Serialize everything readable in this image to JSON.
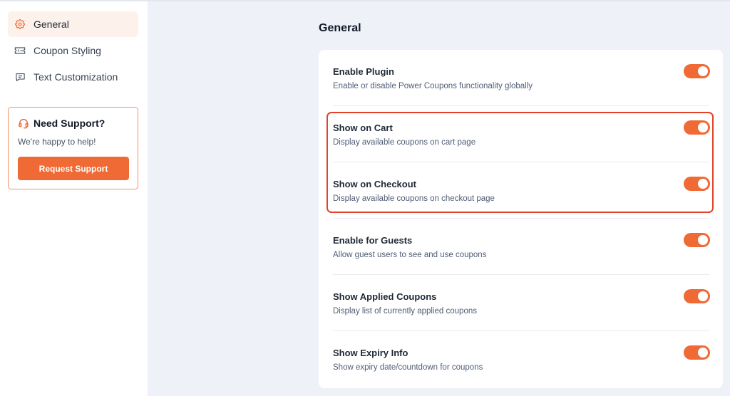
{
  "sidebar": {
    "items": [
      {
        "label": "General",
        "icon": "gear-icon",
        "active": true
      },
      {
        "label": "Coupon Styling",
        "icon": "ticket-icon",
        "active": false
      },
      {
        "label": "Text Customization",
        "icon": "chat-bubble-icon",
        "active": false
      }
    ],
    "support": {
      "title": "Need Support?",
      "subtitle": "We're happy to help!",
      "button_label": "Request Support",
      "icon": "headset-icon"
    }
  },
  "main": {
    "title": "General",
    "settings": [
      {
        "title": "Enable Plugin",
        "description": "Enable or disable Power Coupons functionality globally",
        "enabled": true
      },
      {
        "title": "Show on Cart",
        "description": "Display available coupons on cart page",
        "enabled": true
      },
      {
        "title": "Show on Checkout",
        "description": "Display available coupons on checkout page",
        "enabled": true
      },
      {
        "title": "Enable for Guests",
        "description": "Allow guest users to see and use coupons",
        "enabled": true
      },
      {
        "title": "Show Applied Coupons",
        "description": "Display list of currently applied coupons",
        "enabled": true
      },
      {
        "title": "Show Expiry Info",
        "description": "Show expiry date/countdown for coupons",
        "enabled": true
      }
    ]
  },
  "colors": {
    "accent": "#f06a35",
    "highlight_border": "#e2412a",
    "active_nav_bg": "#fdf1eb",
    "page_bg": "#eef1f7"
  }
}
